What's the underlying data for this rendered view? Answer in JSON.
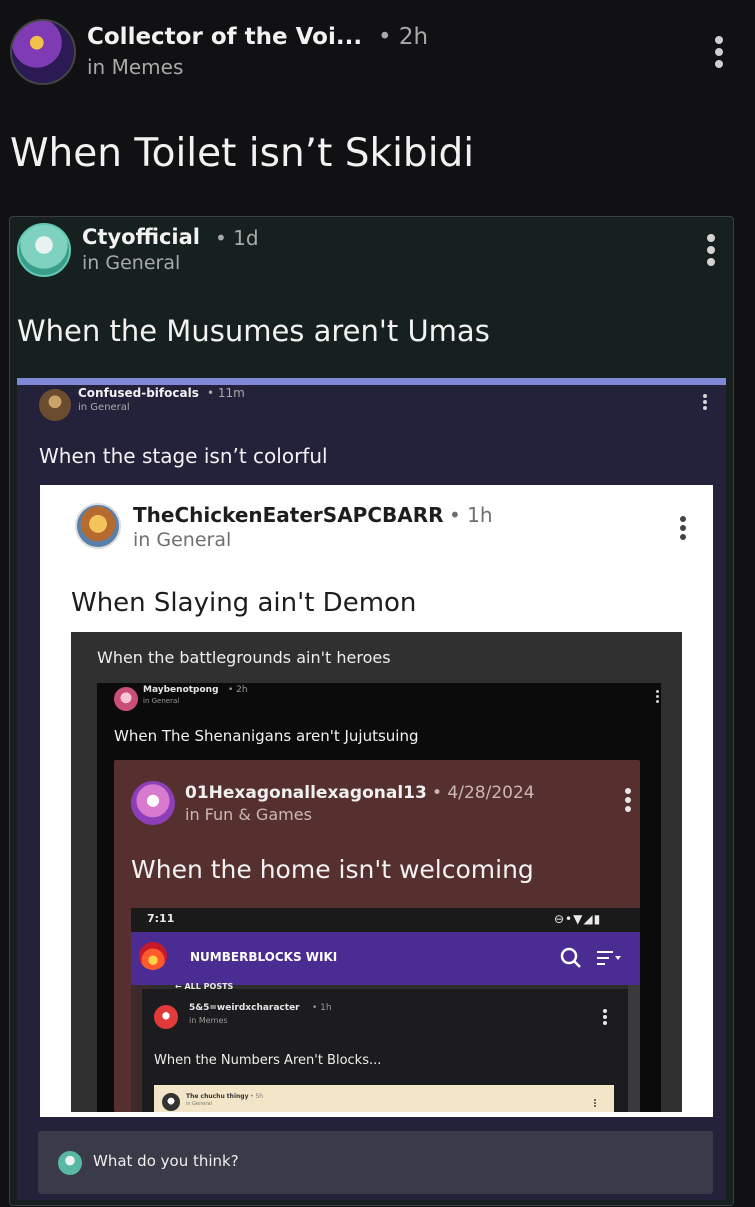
{
  "post": {
    "author": "Collector of the Voi...",
    "time": "• 2h",
    "community": "in Memes",
    "title": "When Toilet isn’t Skibidi"
  },
  "embed1": {
    "author": "Ctyofficial",
    "time": "• 1d",
    "community": "in General",
    "title": "When the Musumes aren't Umas"
  },
  "embed2": {
    "author": "Confused-bifocals",
    "time": "• 11m",
    "community": "in General",
    "title": "When the stage isn’t colorful"
  },
  "embed3": {
    "author": "TheChickenEaterSAPCBARR",
    "time": "• 1h",
    "community": "in General",
    "title": "When Slaying ain't  Demon"
  },
  "embed4": {
    "caption": "When the battlegrounds ain't heroes"
  },
  "embed5": {
    "author": "Maybenotpong",
    "time": "• 2h",
    "community": "in General",
    "title": "When The Shenanigans aren't Jujutsuing"
  },
  "embed6": {
    "author": "01Hexagonallexagonal13",
    "time": "• 4/28/2024",
    "community": "in Fun & Games",
    "title": "When the home isn't welcoming"
  },
  "phone": {
    "clock": "7:11",
    "status_icons": "⊖•▼◢▮",
    "wiki_title": "NUMBERBLOCKS WIKI",
    "all_posts": "← ALL POSTS"
  },
  "embed7": {
    "author": "5&5=weirdxcharacter",
    "time": "• 1h",
    "community": "in Memes",
    "title": "When the Numbers Aren't Blocks..."
  },
  "embed8": {
    "author": "The chuchu thingy",
    "time": "• 5h",
    "community": "in General"
  },
  "comment": {
    "placeholder": "What do you think?"
  },
  "colors": {
    "page_bg": "#111113",
    "embed1_bg": "#16201f",
    "embed2_bg": "#24223a",
    "embed2_accent": "#7f89d8",
    "embed3_bg": "#ffffff",
    "embed4_bg": "#303030",
    "embed5_bg": "#0b0b0b",
    "embed6_bg": "#55302e",
    "wiki_bar": "#4a2c92",
    "embed8_bg": "#f3e6c8"
  }
}
